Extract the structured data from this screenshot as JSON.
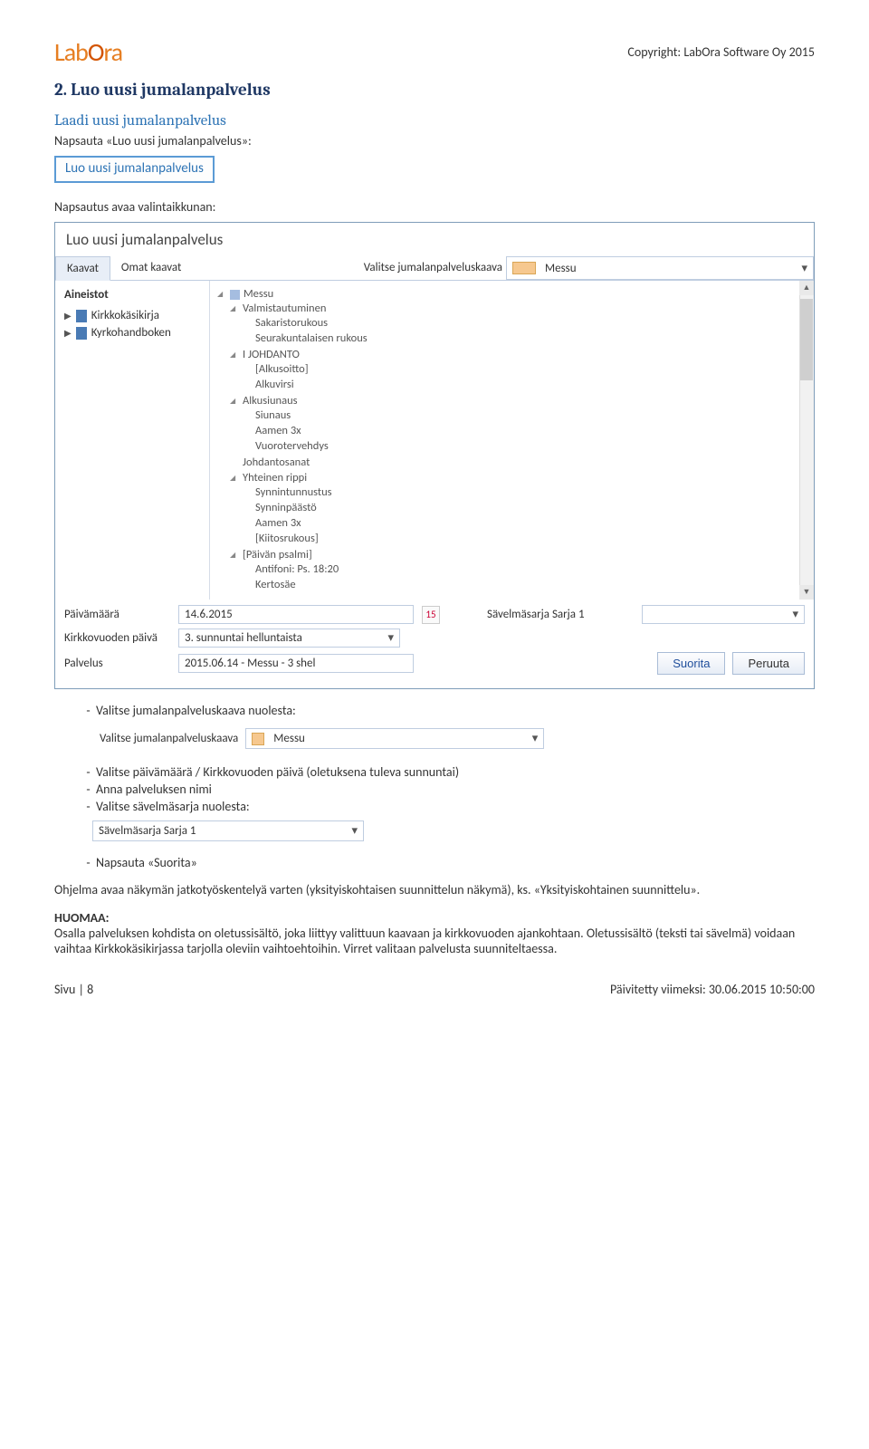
{
  "header": {
    "logo": "LabOra",
    "copyright": "Copyright: LabOra Software Oy 2015"
  },
  "section": {
    "h2": "2. Luo uusi jumalanpalvelus",
    "h3": "Laadi uusi jumalanpalvelus",
    "p1": "Napsauta «Luo uusi jumalanpalvelus»:",
    "button": "Luo uusi jumalanpalvelus",
    "p2": "Napsautus avaa valintaikkunan:"
  },
  "dialog": {
    "title": "Luo uusi jumalanpalvelus",
    "tabs": {
      "t1": "Kaavat",
      "t2": "Omat kaavat",
      "select_label": "Valitse jumalanpalveluskaava",
      "select_value": "Messu"
    },
    "side": {
      "hdr": "Aineistot",
      "items": [
        "Kirkkokäsikirja",
        "Kyrkohandboken"
      ]
    },
    "tree": [
      {
        "t": "Messu",
        "flag": true,
        "children": [
          {
            "t": "Valmistautuminen",
            "children": [
              {
                "t": "Sakaristorukous"
              },
              {
                "t": "Seurakuntalaisen rukous"
              }
            ]
          },
          {
            "t": "I JOHDANTO",
            "children": [
              {
                "t": "[Alkusoitto]"
              },
              {
                "t": "Alkuvirsi"
              }
            ]
          },
          {
            "t": "Alkusiunaus",
            "children": [
              {
                "t": "Siunaus"
              },
              {
                "t": "Aamen 3x"
              },
              {
                "t": "Vuorotervehdys"
              }
            ]
          },
          {
            "t": "Johdantosanat"
          },
          {
            "t": "Yhteinen rippi",
            "children": [
              {
                "t": "Synnintunnustus"
              },
              {
                "t": "Synninpäästö"
              },
              {
                "t": "Aamen 3x"
              },
              {
                "t": "[Kiitosrukous]"
              }
            ]
          },
          {
            "t": "[Päivän psalmi]",
            "children": [
              {
                "t": "Antifoni: Ps. 18:20"
              },
              {
                "t": "Kertosäe"
              }
            ]
          }
        ]
      }
    ],
    "bottom": {
      "date_lbl": "Päivämäärä",
      "date_val": "14.6.2015",
      "cal_num": "15",
      "sarja_lbl": "Sävelmäsarja",
      "sarja_val": "Sarja 1",
      "kday_lbl": "Kirkkovuoden päivä",
      "kday_val": "3. sunnuntai helluntaista",
      "palv_lbl": "Palvelus",
      "palv_val": "2015.06.14 - Messu - 3 shel",
      "btn_ok": "Suorita",
      "btn_cancel": "Peruuta"
    }
  },
  "after_dialog": {
    "bullet1": "Valitse jumalanpalveluskaava nuolesta:",
    "inline": {
      "lbl": "Valitse jumalanpalveluskaava",
      "val": "Messu"
    },
    "bullet2": "Valitse päivämäärä / Kirkkovuoden päivä (oletuksena tuleva sunnuntai)",
    "bullet3": "Anna palveluksen nimi",
    "bullet4": "Valitse sävelmäsarja nuolesta:",
    "sarja": {
      "val": "Sävelmäsarja Sarja 1"
    },
    "bullet5": "Napsauta «Suorita»",
    "p_after": "Ohjelma avaa näkymän jatkotyöskentelyä varten (yksityiskohtaisen suunnittelun näkymä), ks. «Yksityiskohtainen suunnittelu».",
    "note_lbl": "HUOMAA",
    "note_txt": "Osalla palveluksen kohdista on oletussisältö, joka liittyy valittuun kaavaan ja kirkkovuoden ajankohtaan. Oletussisältö (teksti tai sävelmä) voidaan vaihtaa Kirkkokäsikirjassa tarjolla oleviin vaihtoehtoihin. Virret valitaan palvelusta suunniteltaessa."
  },
  "footer": {
    "left": "Sivu | 8",
    "right": "Päivitetty viimeksi: 30.06.2015 10:50:00"
  }
}
